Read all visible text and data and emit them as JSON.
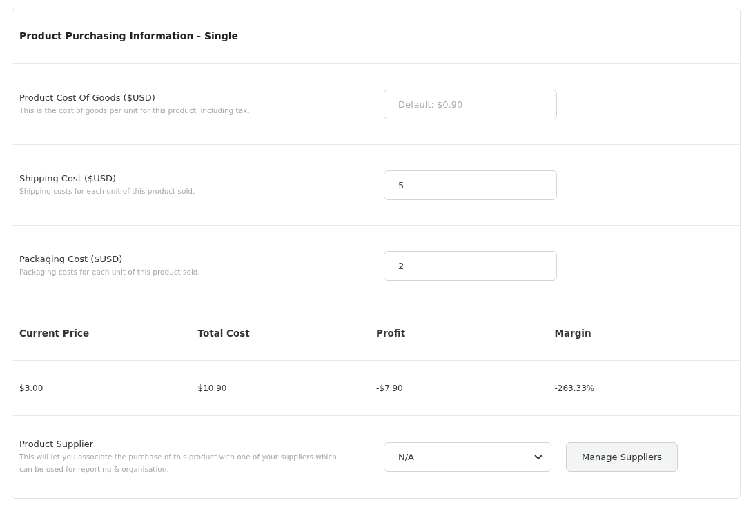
{
  "title": "Product Purchasing Information - Single",
  "fields": [
    {
      "label": "Product Cost Of Goods ($USD)",
      "help": "This is the cost of goods per unit for this product, including tax.",
      "placeholder": "Default: $0.90"
    },
    {
      "label": "Shipping Cost ($USD)",
      "help": "Shipping costs for each unit of this product sold.",
      "value": "5"
    },
    {
      "label": "Packaging Cost ($USD)",
      "help": "Packaging costs for each unit of this product sold.",
      "value": "2"
    }
  ],
  "summary": {
    "columns": [
      "Current Price",
      "Total Cost",
      "Profit",
      "Margin"
    ],
    "values": [
      "$3.00",
      "$10.90",
      "-$7.90",
      "-263.33%"
    ]
  },
  "supplier": {
    "label": "Product Supplier",
    "help": "This will let you associate the purchase of this product with one of your suppliers which can be used for reporting & organisation.",
    "value": "N/A",
    "button": "Manage Suppliers"
  }
}
